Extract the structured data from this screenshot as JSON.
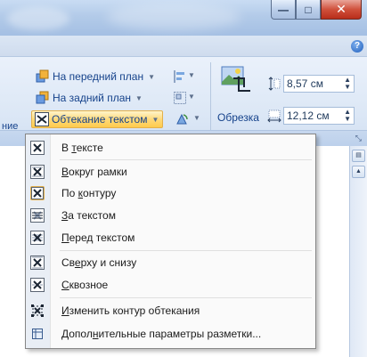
{
  "window": {
    "minimize_glyph": "—",
    "maximize_glyph": "□",
    "close_glyph": "✕"
  },
  "help": {
    "glyph": "?"
  },
  "ribbon": {
    "bring_forward_label": "На передний план",
    "send_backward_label": "На задний план",
    "text_wrap_label": "Обтекание текстом",
    "cut_off_label": "ние",
    "crop_label": "Обрезка",
    "height_value": "8,57 см",
    "width_value": "12,12 см"
  },
  "menu": {
    "items": [
      {
        "label_pre": "В ",
        "label_ul": "т",
        "label_post": "ексте",
        "icon": "wrap-inline-icon",
        "checked": false
      },
      {
        "label_pre": "",
        "label_ul": "В",
        "label_post": "округ рамки",
        "icon": "wrap-square-icon",
        "checked": false
      },
      {
        "label_pre": "По ",
        "label_ul": "к",
        "label_post": "онтуру",
        "icon": "wrap-tight-icon",
        "checked": true
      },
      {
        "label_pre": "",
        "label_ul": "З",
        "label_post": "а текстом",
        "icon": "wrap-behind-icon",
        "checked": false
      },
      {
        "label_pre": "",
        "label_ul": "П",
        "label_post": "еред текстом",
        "icon": "wrap-front-icon",
        "checked": false
      },
      {
        "label_pre": "Св",
        "label_ul": "е",
        "label_post": "рху и снизу",
        "icon": "wrap-topbottom-icon",
        "checked": false
      },
      {
        "label_pre": "",
        "label_ul": "С",
        "label_post": "квозное",
        "icon": "wrap-through-icon",
        "checked": false
      },
      {
        "label_pre": "",
        "label_ul": "И",
        "label_post": "зменить контур обтекания",
        "icon": "edit-wrap-points-icon",
        "checked": false
      },
      {
        "label_pre": "Допол",
        "label_ul": "н",
        "label_post": "ительные параметры разметки...",
        "icon": "layout-options-icon",
        "checked": false
      }
    ]
  },
  "colors": {
    "accent_hover": "#ffd97a",
    "ribbon_text": "#15428b",
    "close_red": "#c9422d"
  }
}
